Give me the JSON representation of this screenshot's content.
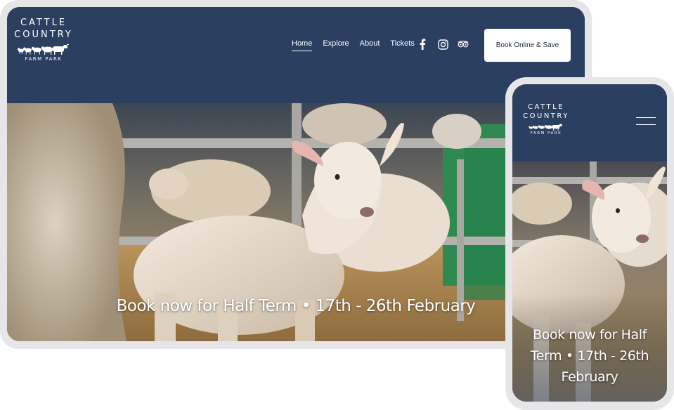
{
  "brand": {
    "line1": "CATTLE",
    "line2": "COUNTRY",
    "line3": "FARM PARK",
    "icon": "farm-animals-silhouette"
  },
  "nav": {
    "items": [
      {
        "label": "Home",
        "active": true
      },
      {
        "label": "Explore",
        "active": false
      },
      {
        "label": "About",
        "active": false
      },
      {
        "label": "Tickets",
        "active": false
      }
    ]
  },
  "socials": [
    {
      "icon": "facebook-icon"
    },
    {
      "icon": "instagram-icon"
    },
    {
      "icon": "tripadvisor-icon"
    }
  ],
  "cta": {
    "label": "Book Online & Save"
  },
  "hero": {
    "caption": "Book now for Half Term  • 17th - 26th February",
    "image": "lambs-in-pen-photo"
  },
  "mobile": {
    "caption": "Book now for Half Term  • 17th - 26th February",
    "menu_icon": "hamburger-menu-icon"
  },
  "colors": {
    "header": "#2b3f61",
    "button_bg": "#ffffff",
    "frame": "#e6e6e8"
  }
}
